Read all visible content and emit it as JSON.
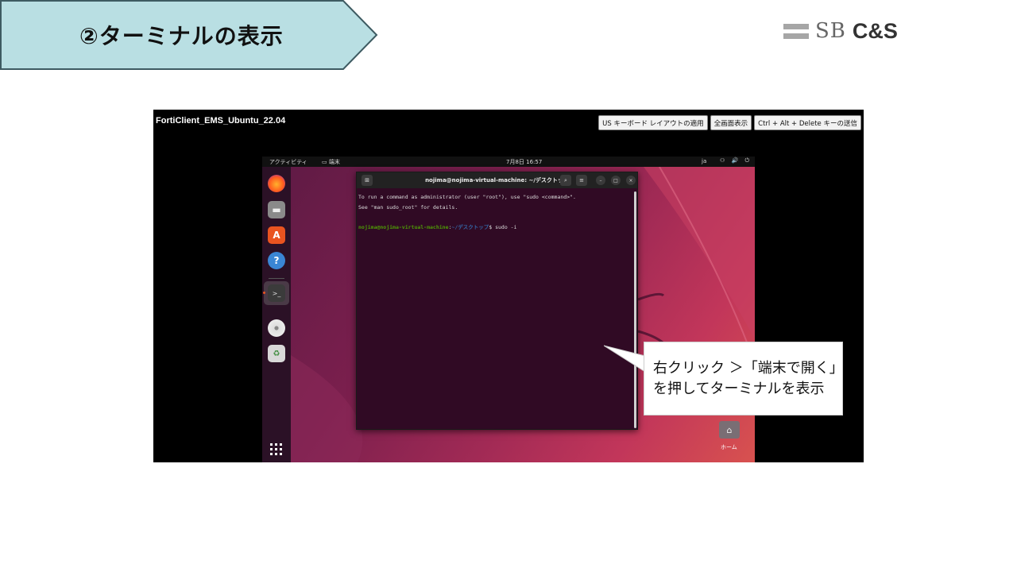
{
  "slide": {
    "title": "②ターミナルの表示",
    "logo": {
      "sb": "SB",
      "cs": "C&S"
    }
  },
  "remote": {
    "title": "FortiClient_EMS_Ubuntu_22.04",
    "buttons": [
      {
        "label": "US キーボード レイアウトの適用"
      },
      {
        "label": "全画面表示"
      },
      {
        "label": "Ctrl + Alt + Delete キーの送信"
      }
    ]
  },
  "ubuntu": {
    "topbar": {
      "activities": "アクティビティ",
      "terminal_app": "端末",
      "clock": "7月8日  16:57",
      "lang": "ja",
      "sys_icons": "⚇ 🔊 ⏻"
    },
    "dock": [
      {
        "icon": "firefox-icon"
      },
      {
        "icon": "files-icon"
      },
      {
        "icon": "software-center-icon"
      },
      {
        "icon": "help-icon"
      },
      {
        "icon": "terminal-icon",
        "active": true
      },
      {
        "icon": "disc-icon"
      },
      {
        "icon": "trash-icon"
      }
    ],
    "terminal": {
      "title": "nojima@nojima-virtual-machine: ~/デスクトップ",
      "line1": "To run a command as administrator (user \"root\"), use \"sudo <command>\".",
      "line2": "See \"man sudo_root\" for details.",
      "prompt_user": "nojima@nojima-virtual-machine",
      "prompt_sep": ":",
      "prompt_path": "~/デスクトップ",
      "command": "$ sudo -i"
    },
    "home_label": "ホーム"
  },
  "callout": {
    "line1": "右クリック ＞「端末で開く」",
    "line2": "を押してターミナルを表示"
  },
  "colors": {
    "banner_fill": "#b9dfe3",
    "banner_border": "#3e5b62",
    "terminal_bg": "#300a24",
    "ubuntu_orange": "#e95420"
  }
}
